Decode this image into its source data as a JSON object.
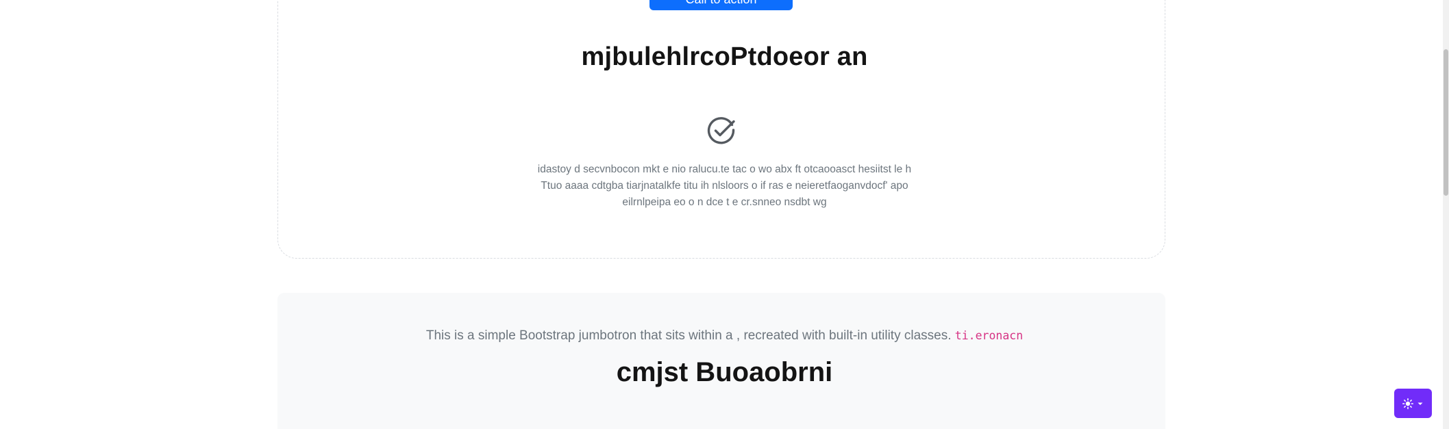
{
  "placeholder_card": {
    "button_label": "Call to action",
    "title": "mjbulehlrcoPtdoeor an",
    "text_lines": [
      "idastoy d secvnbocon mkt e nio ralucu.te tac o wo abx ft otcaooasct hesiitst le h",
      "Ttuo aaaa cdtgba tiarjnatalkfe titu ih nlsloors o if ras e neieretfaoganvdocf' apo",
      "eilrnlpeipa eo o n dce t e cr.snneo nsdbt wg"
    ],
    "icon": "check-circle-icon"
  },
  "jumbotron": {
    "lead": "This is a simple Bootstrap jumbotron that sits within a , recreated with built-in utility classes.",
    "code": "ti.eronacn",
    "title": "cmjst Buoaobrni"
  },
  "theme_toggle": {
    "icon": "sun-icon",
    "accent": "#712cf9"
  },
  "colors": {
    "primary": "#0d6efd",
    "muted_text": "#6c757d",
    "code": "#d63384",
    "jumbotron_bg": "#f8f9fa"
  }
}
